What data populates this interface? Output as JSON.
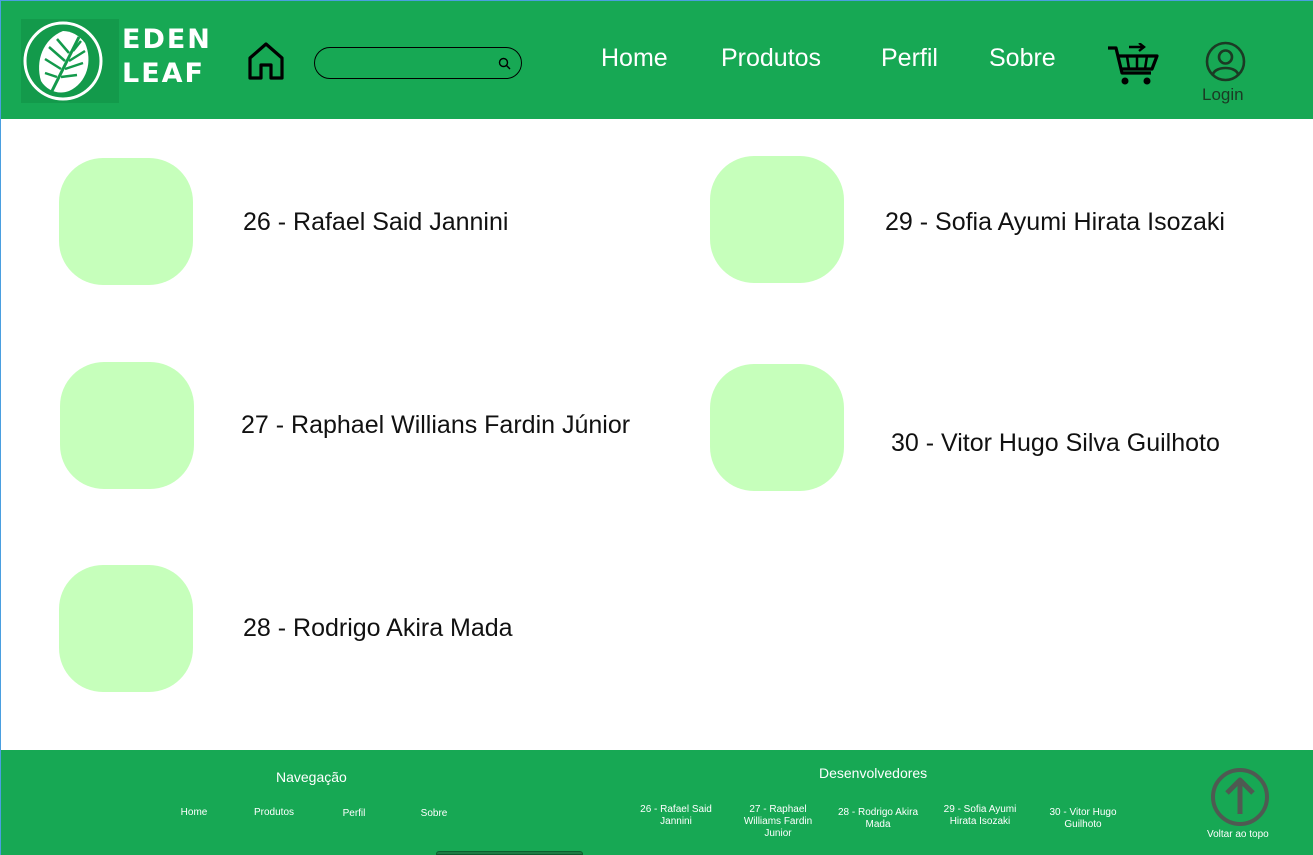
{
  "brand": {
    "line1": "EDEN",
    "line2": "LEAF"
  },
  "search": {
    "placeholder": ""
  },
  "nav": [
    {
      "label": "Home"
    },
    {
      "label": "Produtos"
    },
    {
      "label": "Perfil"
    },
    {
      "label": "Sobre"
    }
  ],
  "account": {
    "login_label": "Login"
  },
  "developers": [
    {
      "label": "26 - Rafael Said Jannini"
    },
    {
      "label": "27 - Raphael Willians Fardin Júnior"
    },
    {
      "label": "28 - Rodrigo Akira Mada"
    },
    {
      "label": "29 - Sofia Ayumi Hirata Isozaki"
    },
    {
      "label": "30 - Vitor Hugo Silva Guilhoto"
    }
  ],
  "footer": {
    "nav_title": "Navegação",
    "nav_links": [
      {
        "label": "Home"
      },
      {
        "label": "Produtos"
      },
      {
        "label": "Perfil"
      },
      {
        "label": "Sobre"
      }
    ],
    "dev_title": "Desenvolvedores",
    "dev_links": [
      {
        "label": "26 - Rafael Said Jannini"
      },
      {
        "label": "27 - Raphael Williams Fardin Junior"
      },
      {
        "label": "28 - Rodrigo Akira Mada"
      },
      {
        "label": "29 - Sofia Ayumi Hirata Isozaki"
      },
      {
        "label": "30 - Vitor Hugo Guilhoto"
      }
    ],
    "back_to_top": "Voltar ao topo"
  },
  "colors": {
    "primary_green": "#17a854",
    "avatar_placeholder": "#c6ffbb"
  },
  "icons": [
    "leaf-logo-icon",
    "home-icon",
    "search-icon",
    "cart-icon",
    "user-icon",
    "arrow-up-circle-icon"
  ]
}
